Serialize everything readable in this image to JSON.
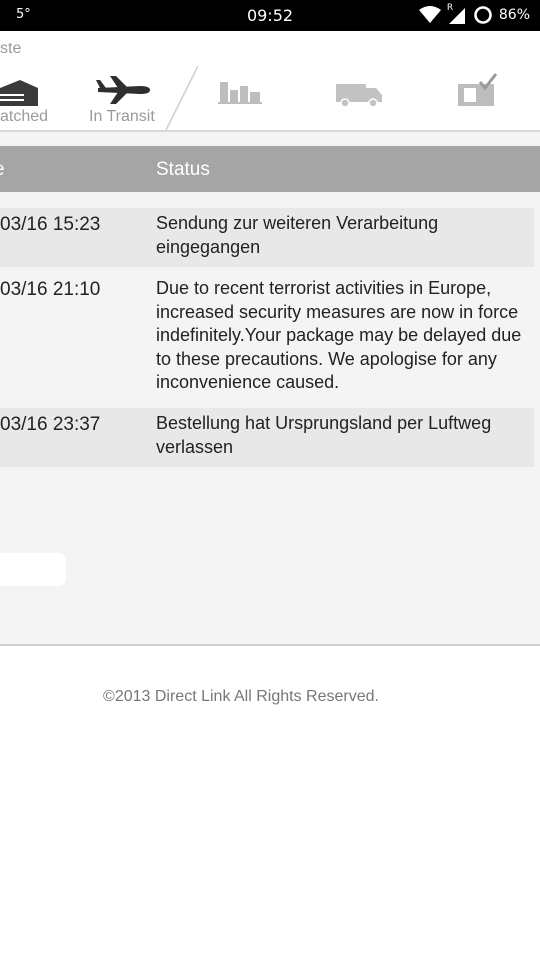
{
  "status_bar": {
    "temperature": "5°",
    "time": "09:52",
    "battery": "86%",
    "roaming_indicator": "R"
  },
  "url_bar": {
    "text": "ste"
  },
  "tracking_steps": [
    {
      "label": "atched",
      "icon": "warehouse-icon"
    },
    {
      "label": "In Transit",
      "icon": "airplane-icon"
    },
    {
      "label": "",
      "icon": "customs-icon"
    },
    {
      "label": "",
      "icon": "delivery-truck-icon"
    },
    {
      "label": "",
      "icon": "delivered-package-icon"
    }
  ],
  "table": {
    "headers": {
      "date": "e",
      "status": "Status"
    },
    "rows": [
      {
        "date": "03/16 15:23",
        "status": "Sendung zur weiteren Verarbeitung eingegangen"
      },
      {
        "date": "03/16 21:10",
        "status": "Due to recent terrorist activities in Europe, increased security measures are now in force indefinitely.Your package may be delayed due to these precautions. We apologise for any inconvenience caused."
      },
      {
        "date": "03/16 23:37",
        "status": "Bestellung hat Ursprungsland per Luftweg verlassen"
      }
    ]
  },
  "footer": {
    "copyright": "©2013 Direct Link All Rights Reserved."
  }
}
